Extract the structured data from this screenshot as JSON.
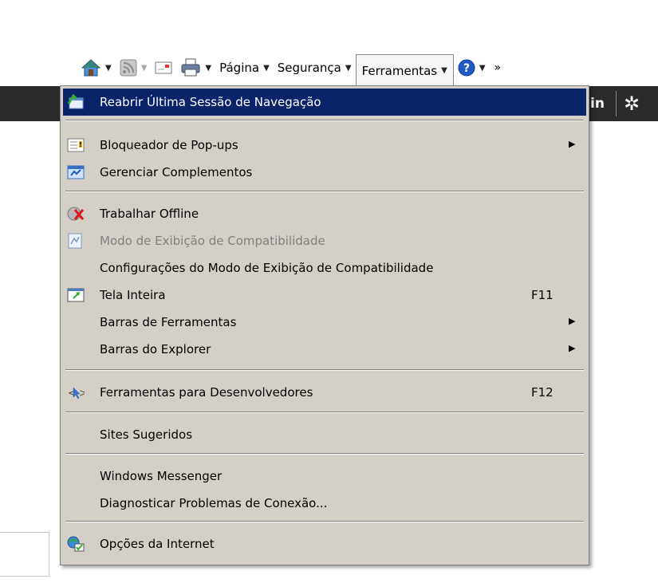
{
  "colors": {
    "heading_red": "#c0001b",
    "menu_bg": "#d4d0c8",
    "highlight": "#0a246a",
    "dark_strip": "#2b2b2b",
    "disabled_text": "#808080"
  },
  "command_bar": {
    "home_icon": "home-icon",
    "feeds_icon": "rss-feed-icon",
    "mail_icon": "read-mail-icon",
    "print_icon": "printer-icon",
    "help_icon": "help-icon",
    "page_label": "Página",
    "security_label": "Segurança",
    "tools_label": "Ferramentas",
    "more_label": "»"
  },
  "dark_bar": {
    "signin_text": "in",
    "gear_icon": "gear-icon"
  },
  "menu": {
    "items": [
      {
        "label": "Reabrir Última Sessão de Navegação",
        "icon": "reopen-session-icon",
        "highlighted": true
      },
      {
        "label": "Bloqueador de Pop-ups",
        "icon": "popup-blocker-icon",
        "submenu": true
      },
      {
        "label": "Gerenciar Complementos",
        "icon": "manage-addons-icon"
      },
      {
        "label": "Trabalhar Offline",
        "icon": "work-offline-icon"
      },
      {
        "label": "Modo de Exibição de Compatibilidade",
        "icon": "compatibility-view-icon",
        "disabled": true
      },
      {
        "label": "Configurações do Modo de Exibição de Compatibilidade"
      },
      {
        "label": "Tela Inteira",
        "icon": "full-screen-icon",
        "shortcut": "F11"
      },
      {
        "label": "Barras de Ferramentas",
        "submenu": true
      },
      {
        "label": "Barras do Explorer",
        "submenu": true
      },
      {
        "label": "Ferramentas para Desenvolvedores",
        "icon": "developer-tools-icon",
        "shortcut": "F12"
      },
      {
        "label": "Sites Sugeridos"
      },
      {
        "label": "Windows Messenger"
      },
      {
        "label": "Diagnosticar Problemas de Conexão..."
      },
      {
        "label": "Opções da Internet",
        "icon": "internet-options-icon"
      }
    ]
  }
}
